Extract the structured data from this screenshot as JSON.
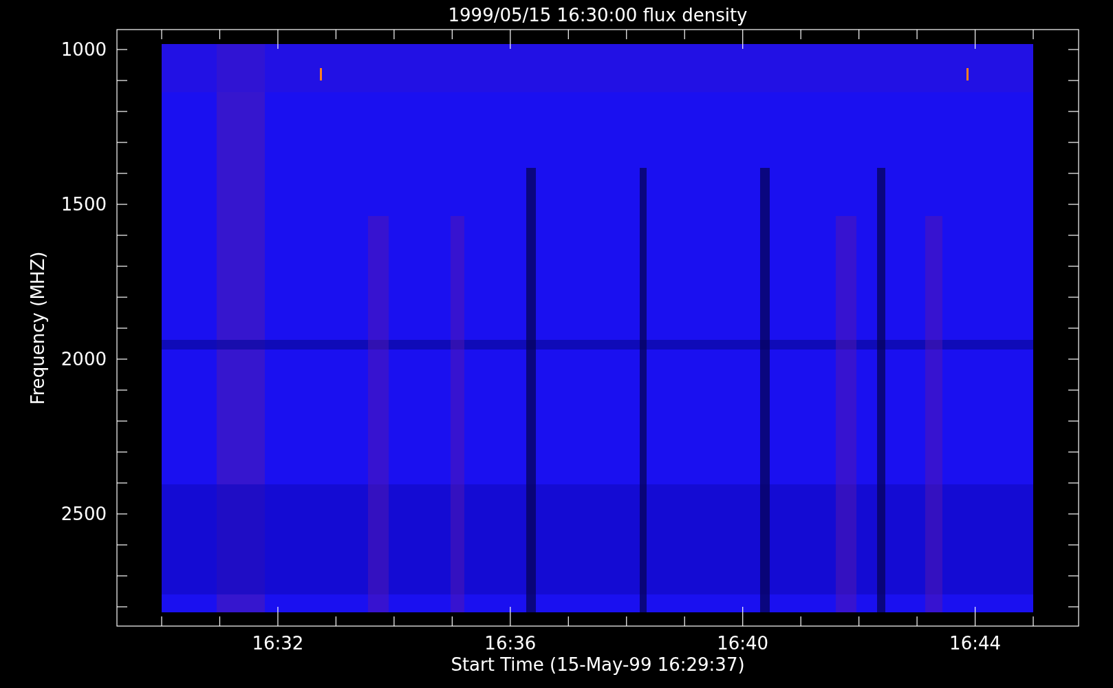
{
  "plot": {
    "title": "1999/05/15 16:30:00 flux density",
    "ylabel": "Frequency (MHZ)",
    "xlabel": "Start Time (15-May-99 16:29:37)",
    "yticks": [
      "1000",
      "1500",
      "2000",
      "2500"
    ],
    "xticks": [
      "16:32",
      "16:36",
      "16:40",
      "16:44"
    ]
  }
}
